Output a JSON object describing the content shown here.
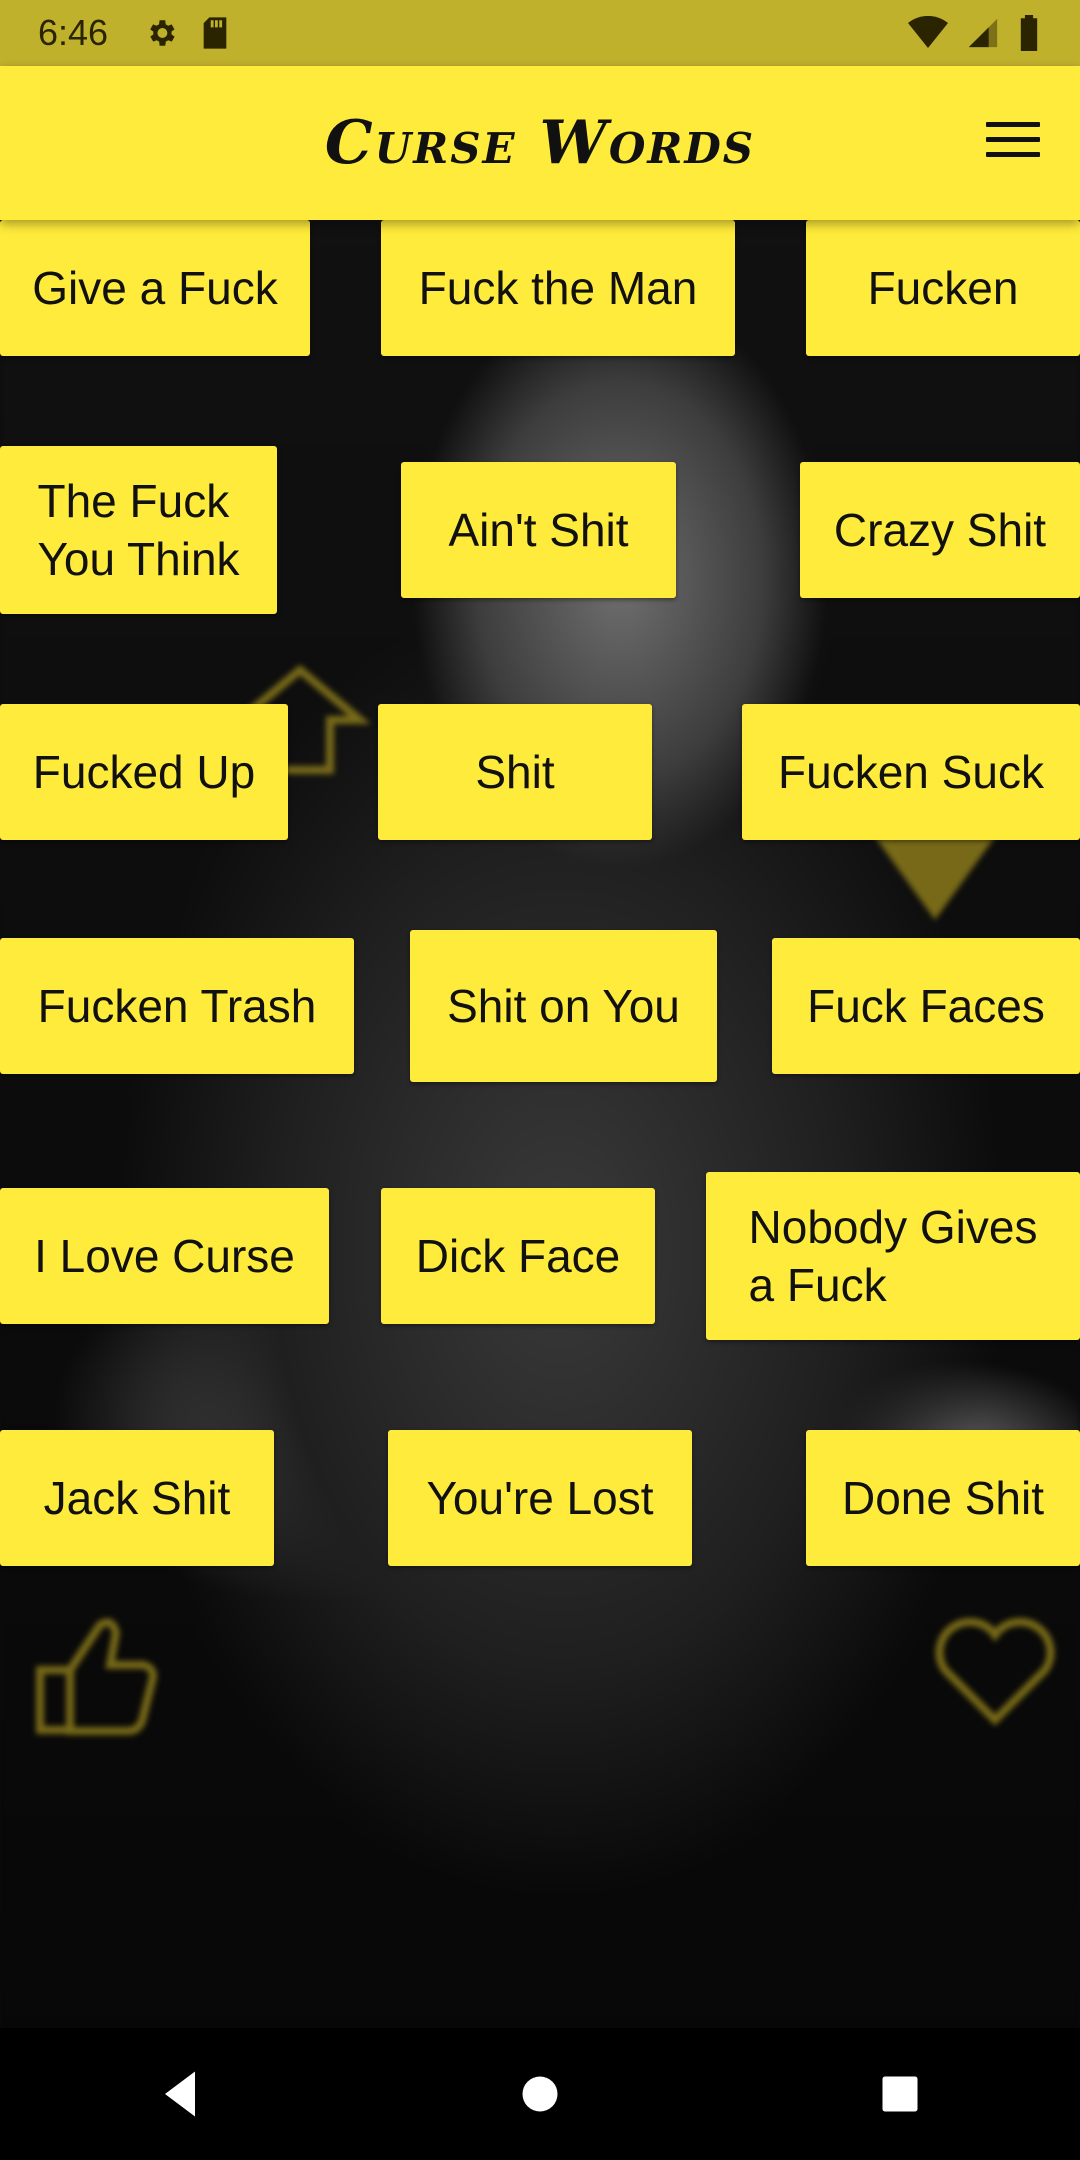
{
  "status_bar": {
    "time": "6:46",
    "icons_left": [
      "gear-icon",
      "sd-card-icon"
    ],
    "icons_right": [
      "wifi-icon",
      "signal-icon",
      "battery-icon"
    ]
  },
  "app_bar": {
    "title": "Curse Words",
    "menu_icon": "hamburger-menu-icon",
    "background": "#ffeb3b"
  },
  "buttons": [
    {
      "label": "Give a Fuck"
    },
    {
      "label": "Fuck the Man"
    },
    {
      "label": "Fucken"
    },
    {
      "label": "The Fuck\nYou Think"
    },
    {
      "label": "Ain't Shit"
    },
    {
      "label": "Crazy Shit"
    },
    {
      "label": "Fucked Up"
    },
    {
      "label": "Shit"
    },
    {
      "label": "Fucken Suck"
    },
    {
      "label": "Fucken Trash"
    },
    {
      "label": "Shit on You"
    },
    {
      "label": "Fuck Faces"
    },
    {
      "label": "I Love Curse"
    },
    {
      "label": "Dick Face"
    },
    {
      "label": "Nobody Gives\n a Fuck"
    },
    {
      "label": "Jack Shit"
    },
    {
      "label": "You're Lost"
    },
    {
      "label": "Done Shit"
    }
  ],
  "nav_bar": {
    "icons": [
      "back-icon",
      "home-icon",
      "recents-icon"
    ]
  }
}
